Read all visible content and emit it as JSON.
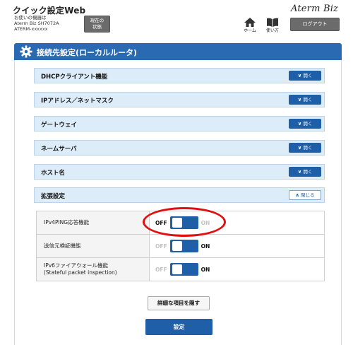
{
  "header": {
    "app_title": "クイック設定Web",
    "device_label": "お使いの機器は",
    "device_model": "Aterm Biz SH7072A",
    "device_id": "ATERM-xxxxxx",
    "status_button": {
      "line1": "現在の",
      "line2": "状態"
    },
    "brand": "Aterm Biz",
    "home_label": "ホーム",
    "help_label": "使い方",
    "logout_label": "ログアウト"
  },
  "section": {
    "title": "接続先設定(ローカルルータ)",
    "icon": "gear-icon"
  },
  "accordions": [
    {
      "label": "DHCPクライアント機能",
      "button": "開く"
    },
    {
      "label": "IPアドレス／ネットマスク",
      "button": "開く"
    },
    {
      "label": "ゲートウェイ",
      "button": "開く"
    },
    {
      "label": "ネームサーバ",
      "button": "開く"
    },
    {
      "label": "ホスト名",
      "button": "開く"
    },
    {
      "label": "拡張設定",
      "button": "閉じる"
    }
  ],
  "settings": [
    {
      "label": "IPv4PING応答機能",
      "label2": "",
      "off": "OFF",
      "on": "ON",
      "value": "OFF"
    },
    {
      "label": "送信元検証機能",
      "label2": "",
      "off": "OFF",
      "on": "ON",
      "value": "ON"
    },
    {
      "label": "IPv6ファイアウォール機能",
      "label2": "(Stateful packet inspection)",
      "off": "OFF",
      "on": "ON",
      "value": "ON"
    }
  ],
  "buttons": {
    "hide_details": "詳細な項目を隠す",
    "submit": "設定"
  },
  "colors": {
    "primary": "#1f5fa8",
    "section_bar": "#2a6ab3",
    "accordion_bg": "#dcecf8",
    "highlight": "#e01010"
  }
}
